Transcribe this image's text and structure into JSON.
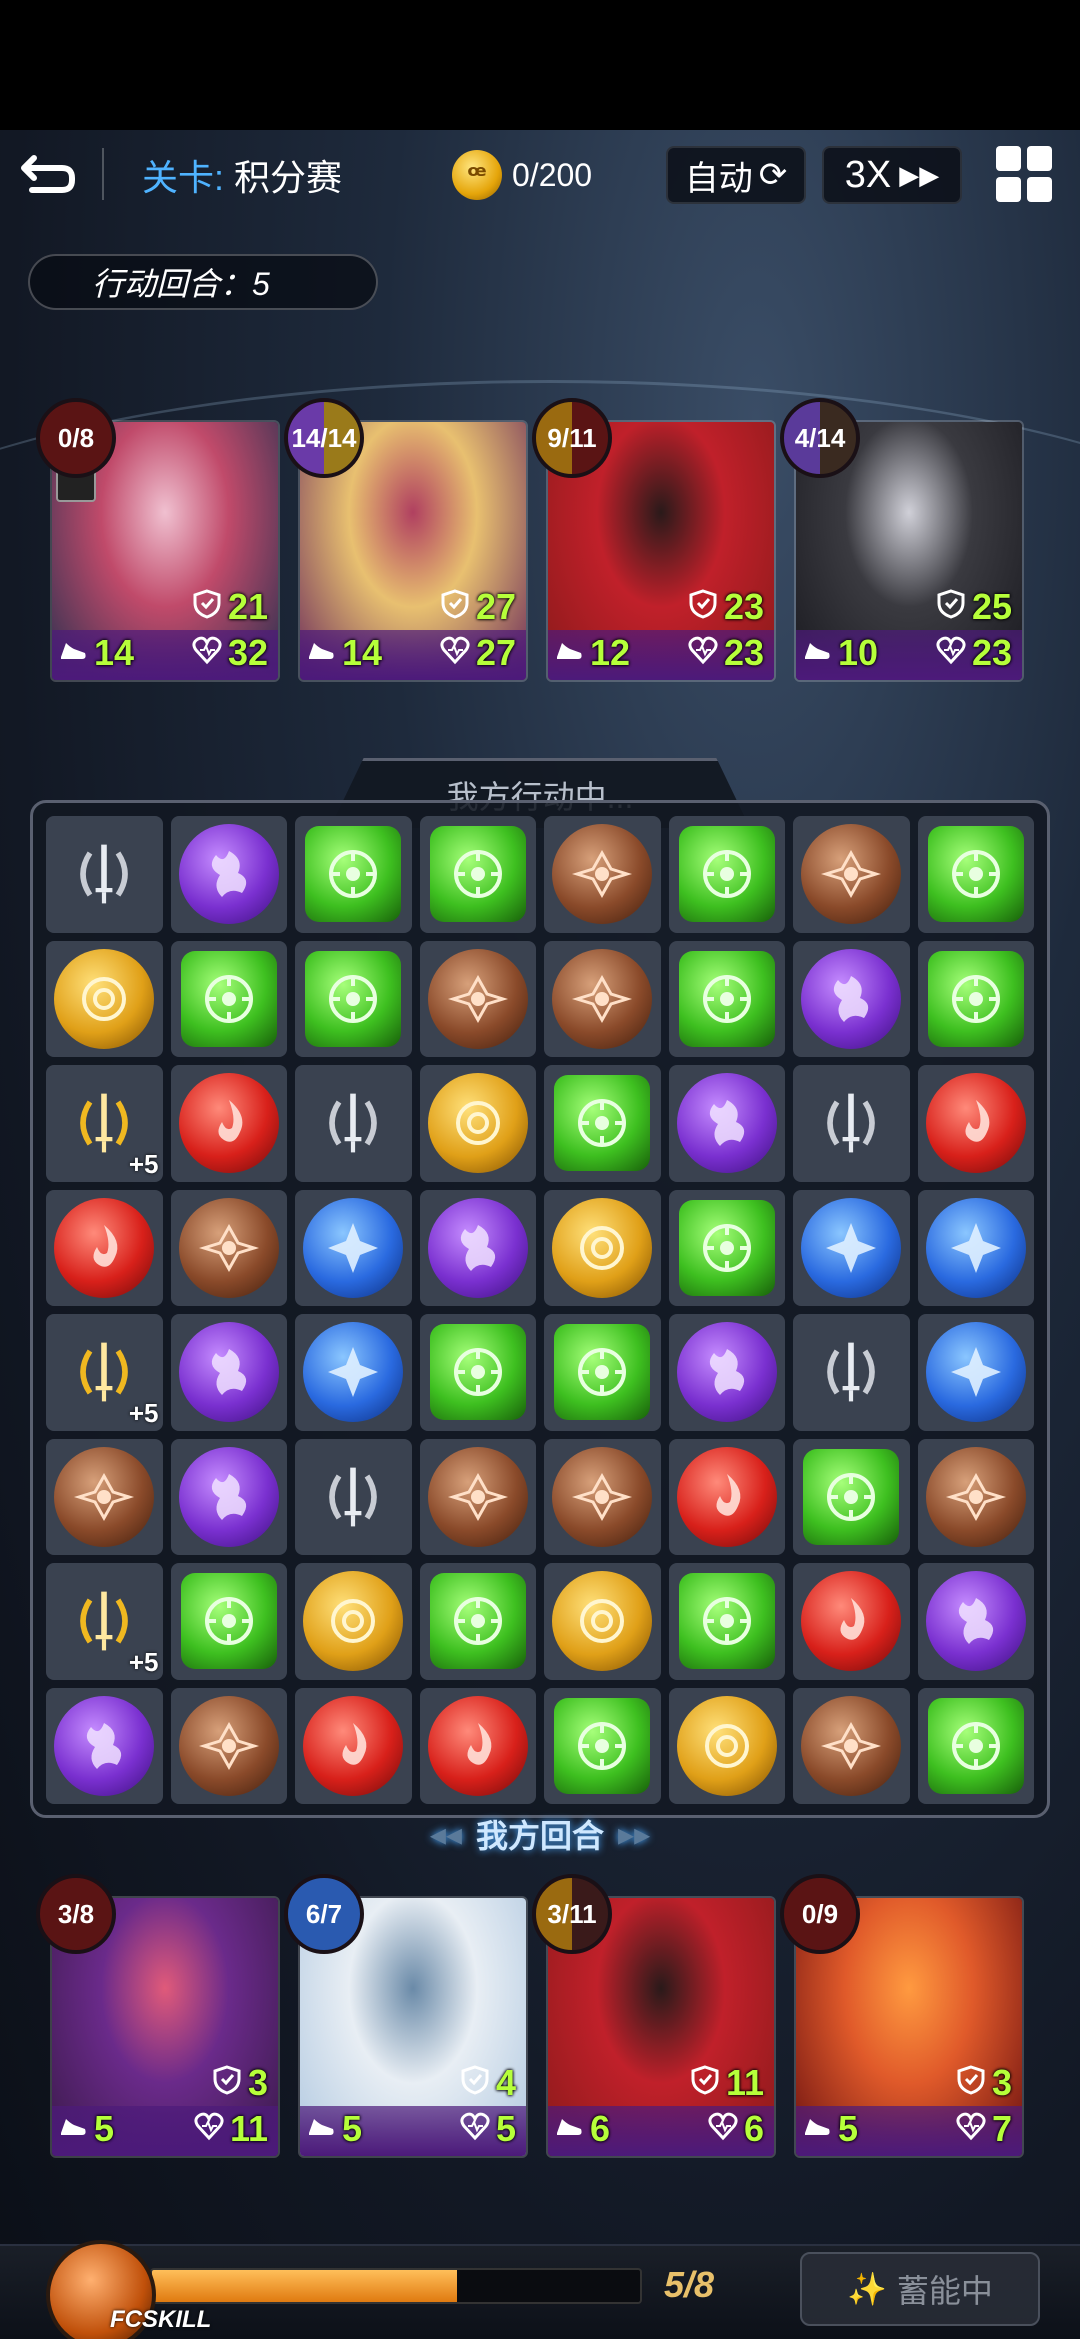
{
  "header": {
    "stage_prefix": "关卡:",
    "stage_name": "积分赛",
    "coin_text": "0/200",
    "auto_label": "自动",
    "speed_label": "3X"
  },
  "round_label": "行动回合：5",
  "board_status": "我方行动中...",
  "board_footer": "我方回合",
  "enemy_cards": [
    {
      "badge": "0/8",
      "def": "21",
      "spd": "14",
      "hp": "32"
    },
    {
      "badge": "14/14",
      "def": "27",
      "spd": "14",
      "hp": "27"
    },
    {
      "badge": "9/11",
      "def": "23",
      "spd": "12",
      "hp": "23"
    },
    {
      "badge": "4/14",
      "def": "25",
      "spd": "10",
      "hp": "23"
    }
  ],
  "ally_cards": [
    {
      "badge": "3/8",
      "def": "3",
      "spd": "5",
      "hp": "11"
    },
    {
      "badge": "6/7",
      "def": "4",
      "spd": "5",
      "hp": "5"
    },
    {
      "badge": "3/11",
      "def": "11",
      "spd": "6",
      "hp": "6"
    },
    {
      "badge": "0/9",
      "def": "3",
      "spd": "5",
      "hp": "7"
    }
  ],
  "board": [
    [
      "sword",
      "purple",
      "green",
      "green",
      "brown",
      "green",
      "brown",
      "green"
    ],
    [
      "gold",
      "green",
      "green",
      "brown",
      "brown",
      "green",
      "purple",
      "green"
    ],
    [
      "gsword",
      "red",
      "sword",
      "gold",
      "green",
      "purple",
      "sword",
      "red"
    ],
    [
      "red",
      "brown",
      "blue",
      "purple",
      "gold",
      "green",
      "blue",
      "blue"
    ],
    [
      "gsword",
      "purple",
      "blue",
      "green",
      "green",
      "purple",
      "sword",
      "blue"
    ],
    [
      "brown",
      "purple",
      "sword",
      "brown",
      "brown",
      "red",
      "green",
      "brown"
    ],
    [
      "gsword",
      "green",
      "gold",
      "green",
      "gold",
      "green",
      "red",
      "purple"
    ],
    [
      "purple",
      "brown",
      "red",
      "red",
      "green",
      "gold",
      "brown",
      "green"
    ]
  ],
  "plus_label": "+5",
  "fcskill": {
    "label": "FCSKILL",
    "count": "5/8",
    "progress_fraction": 0.625,
    "charge_label": "蓄能中"
  }
}
